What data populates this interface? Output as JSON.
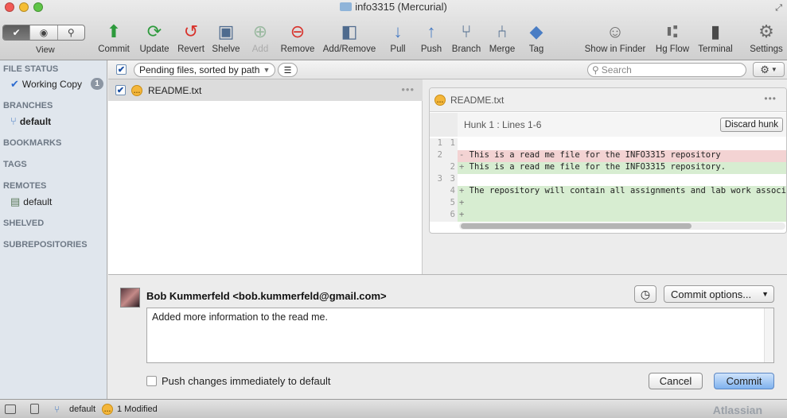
{
  "window": {
    "title": "info3315 (Mercurial)"
  },
  "toolbar": {
    "view_label": "View",
    "tools": [
      {
        "name": "commit",
        "label": "Commit",
        "icon": "commit-icon",
        "color": "#2d9a3c"
      },
      {
        "name": "update",
        "label": "Update",
        "icon": "update-icon",
        "color": "#2d9a3c"
      },
      {
        "name": "revert",
        "label": "Revert",
        "icon": "revert-icon",
        "color": "#d8322b"
      },
      {
        "name": "shelve",
        "label": "Shelve",
        "icon": "shelve-icon",
        "color": "#4f6b8e"
      },
      {
        "name": "add",
        "label": "Add",
        "icon": "add-icon",
        "color": "#9ab9a0"
      },
      {
        "name": "remove",
        "label": "Remove",
        "icon": "remove-icon",
        "color": "#d8322b"
      },
      {
        "name": "add-remove",
        "label": "Add/Remove",
        "icon": "add-remove-icon",
        "color": "#4f6b8e"
      },
      {
        "name": "pull",
        "label": "Pull",
        "icon": "pull-icon",
        "color": "#4a7dc4"
      },
      {
        "name": "push",
        "label": "Push",
        "icon": "push-icon",
        "color": "#4a7dc4"
      },
      {
        "name": "branch",
        "label": "Branch",
        "icon": "branch-icon",
        "color": "#4f6b8e"
      },
      {
        "name": "merge",
        "label": "Merge",
        "icon": "merge-icon",
        "color": "#4f6b8e"
      },
      {
        "name": "tag",
        "label": "Tag",
        "icon": "tag-icon",
        "color": "#4a7dc4"
      },
      {
        "name": "show-in-finder",
        "label": "Show in Finder",
        "icon": "finder-icon",
        "color": "#6b6b6b"
      },
      {
        "name": "hg-flow",
        "label": "Hg Flow",
        "icon": "hg-flow-icon",
        "color": "#6b6b6b"
      },
      {
        "name": "terminal",
        "label": "Terminal",
        "icon": "terminal-icon",
        "color": "#4a4a4a"
      },
      {
        "name": "settings",
        "label": "Settings",
        "icon": "settings-icon",
        "color": "#6b6b6b"
      }
    ]
  },
  "sidebar": {
    "file_status": "FILE STATUS",
    "working_copy": "Working Copy",
    "working_copy_count": "1",
    "branches": "BRANCHES",
    "branch_default": "default",
    "bookmarks": "BOOKMARKS",
    "tags": "TAGS",
    "remotes": "REMOTES",
    "remote_default": "default",
    "shelved": "SHELVED",
    "subrepositories": "SUBREPOSITORIES"
  },
  "filebar": {
    "sort_label": "Pending files, sorted by path",
    "search_placeholder": "Search"
  },
  "files": [
    {
      "name": "README.txt",
      "status": "modified",
      "checked": true
    }
  ],
  "diff": {
    "file": "README.txt",
    "hunk_title": "Hunk 1 : Lines 1-6",
    "discard_label": "Discard hunk",
    "lines": [
      {
        "kind": "ctx",
        "old": "1",
        "new": "1",
        "mark": "",
        "text": ""
      },
      {
        "kind": "del",
        "old": "2",
        "new": "",
        "mark": "-",
        "text": "This is a read me file for the INFO3315 repository"
      },
      {
        "kind": "add",
        "old": "",
        "new": "2",
        "mark": "+",
        "text": "This is a read me file for the INFO3315 repository."
      },
      {
        "kind": "ctx",
        "old": "3",
        "new": "3",
        "mark": "",
        "text": ""
      },
      {
        "kind": "add",
        "old": "",
        "new": "4",
        "mark": "+",
        "text": "The repository will contain all assignments and lab work associate"
      },
      {
        "kind": "add",
        "old": "",
        "new": "5",
        "mark": "+",
        "text": ""
      },
      {
        "kind": "add",
        "old": "",
        "new": "6",
        "mark": "+",
        "text": ""
      }
    ]
  },
  "commit": {
    "author": "Bob Kummerfeld <bob.kummerfeld@gmail.com>",
    "options_label": "Commit options...",
    "message": "Added more information to the read me.",
    "push_label": "Push changes immediately to default",
    "cancel_label": "Cancel",
    "commit_label": "Commit"
  },
  "statusbar": {
    "branch": "default",
    "modified": "1 Modified",
    "brand": "Atlassian"
  }
}
